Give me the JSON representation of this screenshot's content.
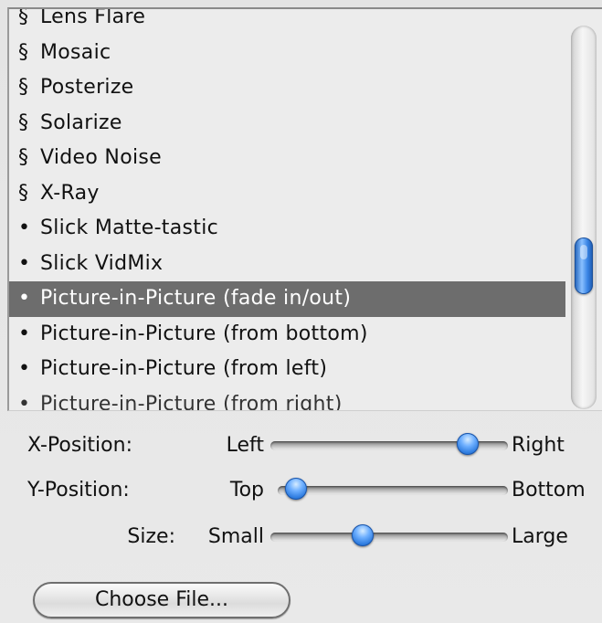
{
  "list": {
    "items": [
      {
        "bullet": "§",
        "label": "Lens Flare"
      },
      {
        "bullet": "§",
        "label": "Mosaic"
      },
      {
        "bullet": "§",
        "label": "Posterize"
      },
      {
        "bullet": "§",
        "label": "Solarize"
      },
      {
        "bullet": "§",
        "label": "Video Noise"
      },
      {
        "bullet": "§",
        "label": "X-Ray"
      },
      {
        "bullet": "•",
        "label": "Slick Matte-tastic"
      },
      {
        "bullet": "•",
        "label": "Slick VidMix"
      },
      {
        "bullet": "•",
        "label": "Picture-in-Picture (fade in/out)",
        "selected": true
      },
      {
        "bullet": "•",
        "label": "Picture-in-Picture (from bottom)"
      },
      {
        "bullet": "•",
        "label": "Picture-in-Picture (from left)"
      },
      {
        "bullet": "•",
        "label": "Picture-in-Picture (from right)"
      }
    ],
    "scroll_position": 0.65
  },
  "controls": {
    "x_position": {
      "label": "X-Position:",
      "min_label": "Left",
      "max_label": "Right",
      "value": 0.83
    },
    "y_position": {
      "label": "Y-Position:",
      "min_label": "Top",
      "max_label": "Bottom",
      "value": 0.08
    },
    "size": {
      "label": "Size:",
      "min_label": "Small",
      "max_label": "Large",
      "value": 0.39
    }
  },
  "choose_file_button": {
    "label": "Choose File..."
  },
  "colors": {
    "selection": "#6d6d6d",
    "thumb": "#2f7de0"
  }
}
